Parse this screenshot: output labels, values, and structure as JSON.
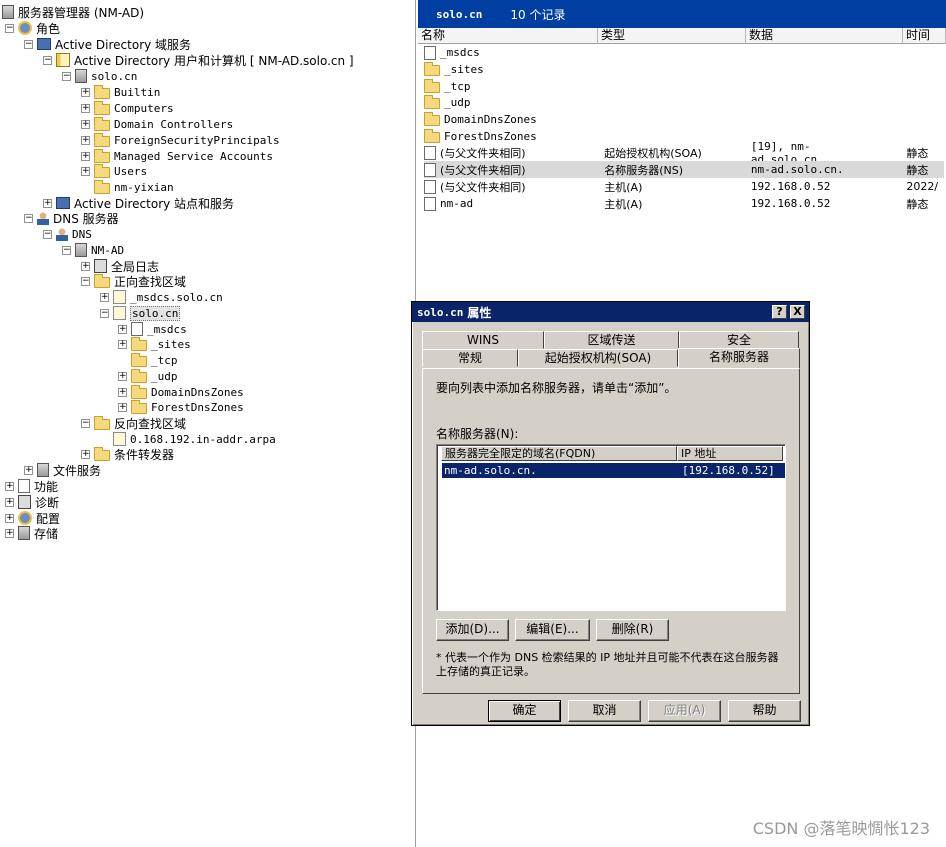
{
  "tree": {
    "root": "服务器管理器 (NM-AD)",
    "roles": "角色",
    "ad_ds": "Active Directory 域服务",
    "ad_users": "Active Directory 用户和计算机 [ NM-AD.solo.cn ]",
    "domain": "solo.cn",
    "ou_items": [
      "Builtin",
      "Computers",
      "Domain Controllers",
      "ForeignSecurityPrincipals",
      "Managed Service Accounts",
      "Users",
      "nm-yixian"
    ],
    "ad_sites": "Active Directory 站点和服务",
    "dns_server": "DNS 服务器",
    "dns": "DNS",
    "nm_ad": "NM-AD",
    "global_log": "全局日志",
    "forward_zones": "正向查找区域",
    "msdcs_zone": "_msdcs.solo.cn",
    "solo_zone": "solo.cn",
    "zone_children": [
      "_msdcs",
      "_sites",
      "_tcp",
      "_udp",
      "DomainDnsZones",
      "ForestDnsZones"
    ],
    "reverse_zones": "反向查找区域",
    "reverse_zone": "0.168.192.in-addr.arpa",
    "conditional": "条件转发器",
    "file_services": "文件服务",
    "features": "功能",
    "diagnostics": "诊断",
    "config": "配置",
    "storage": "存储"
  },
  "list": {
    "title": "solo.cn",
    "count": "10 个记录",
    "columns": [
      "名称",
      "类型",
      "数据",
      "时间"
    ],
    "rows": [
      {
        "name": "_msdcs",
        "type": "",
        "data": "",
        "time": ""
      },
      {
        "name": "_sites",
        "type": "",
        "data": "",
        "time": ""
      },
      {
        "name": "_tcp",
        "type": "",
        "data": "",
        "time": ""
      },
      {
        "name": "_udp",
        "type": "",
        "data": "",
        "time": ""
      },
      {
        "name": "DomainDnsZones",
        "type": "",
        "data": "",
        "time": ""
      },
      {
        "name": "ForestDnsZones",
        "type": "",
        "data": "",
        "time": ""
      },
      {
        "name": "(与父文件夹相同)",
        "type": "起始授权机构(SOA)",
        "data": "[19], nm-ad.solo.cn.,...",
        "time": "静态"
      },
      {
        "name": "(与父文件夹相同)",
        "type": "名称服务器(NS)",
        "data": "nm-ad.solo.cn.",
        "time": "静态"
      },
      {
        "name": "(与父文件夹相同)",
        "type": "主机(A)",
        "data": "192.168.0.52",
        "time": "2022/"
      },
      {
        "name": "nm-ad",
        "type": "主机(A)",
        "data": "192.168.0.52",
        "time": "静态"
      }
    ]
  },
  "dialog": {
    "title_en": "solo.cn",
    "title_cn": "属性",
    "help_btn": "?",
    "close_btn": "X",
    "tabs_back": [
      "WINS",
      "区域传送",
      "安全"
    ],
    "tabs_front": [
      "常规",
      "起始授权机构(SOA)",
      "名称服务器"
    ],
    "instruction": "要向列表中添加名称服务器，请单击“添加”。",
    "ns_label": "名称服务器(N):",
    "col_fqdn": "服务器完全限定的域名(FQDN)",
    "col_ip": "IP 地址",
    "ns_fqdn": "nm-ad.solo.cn.",
    "ns_ip": "[192.168.0.52]",
    "add": "添加(D)...",
    "edit": "编辑(E)...",
    "remove": "删除(R)",
    "note": "* 代表一个作为 DNS 检索结果的 IP 地址并且可能不代表在这台服务器上存储的真正记录。",
    "ok": "确定",
    "cancel": "取消",
    "apply": "应用(A)",
    "help": "帮助"
  },
  "watermark": "CSDN @落笔映惆怅123"
}
